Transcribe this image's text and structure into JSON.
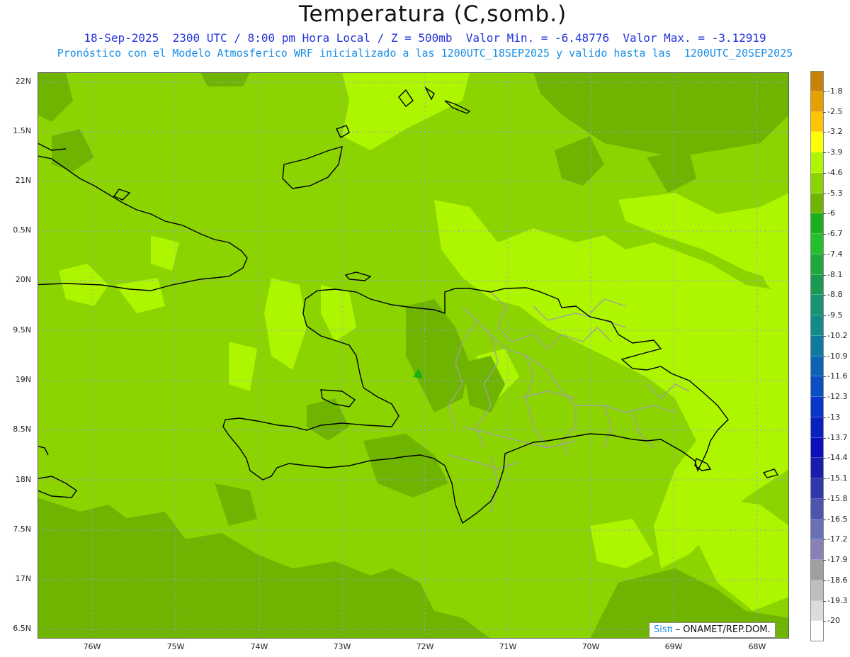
{
  "header": {
    "title": "Temperatura (C,somb.)",
    "line1": "18-Sep-2025  2300 UTC / 8:00 pm Hora Local / Z = 500mb  Valor Min. = -6.48776  Valor Max. = -3.12919",
    "line2": "Pronóstico con el Modelo Atmosferico WRF inicializado a las 1200UTC_18SEP2025 y valido hasta las  1200UTC_20SEP2025"
  },
  "axes": {
    "y_ticks": [
      "22N",
      "1.5N",
      "21N",
      "0.5N",
      "20N",
      "9.5N",
      "19N",
      "8.5N",
      "18N",
      "7.5N",
      "17N",
      "6.5N"
    ],
    "x_ticks": [
      "76W",
      "75W",
      "74W",
      "73W",
      "72W",
      "71W",
      "70W",
      "69W",
      "68W"
    ]
  },
  "colorbar": {
    "labels": [
      "-1.8",
      "-2.5",
      "-3.2",
      "-3.9",
      "-4.6",
      "-5.3",
      "-6",
      "-6.7",
      "-7.4",
      "-8.1",
      "-8.8",
      "-9.5",
      "-10.2",
      "-10.9",
      "-11.6",
      "-12.3",
      "-13",
      "-13.7",
      "-14.4",
      "-15.1",
      "-15.8",
      "-16.5",
      "-17.2",
      "-17.9",
      "-18.6",
      "-19.3",
      "-20"
    ],
    "colors": [
      "#c8820a",
      "#e6a000",
      "#ffc400",
      "#ffff00",
      "#aef500",
      "#8cd400",
      "#6fb400",
      "#19b01e",
      "#22c02c",
      "#1fa83c",
      "#1a9a50",
      "#189470",
      "#128a88",
      "#0e7aa0",
      "#0b64b4",
      "#0a4ec4",
      "#0836c8",
      "#0820c0",
      "#0a10b8",
      "#1a1cb0",
      "#3038aa",
      "#4c56ae",
      "#6a70b4",
      "#8a80b8",
      "#a0a0a0",
      "#bebebe",
      "#dcdcdc",
      "#ffffff"
    ]
  },
  "credit": {
    "brand": "Sisπ",
    "text": " – ONAMET/REP.DOM."
  },
  "map_colors": {
    "base": "#8cd400",
    "light": "#aef500",
    "dark": "#6fb400",
    "darkest": "#19b01e",
    "coast": "#000000",
    "borders": "#a0a0a0"
  }
}
